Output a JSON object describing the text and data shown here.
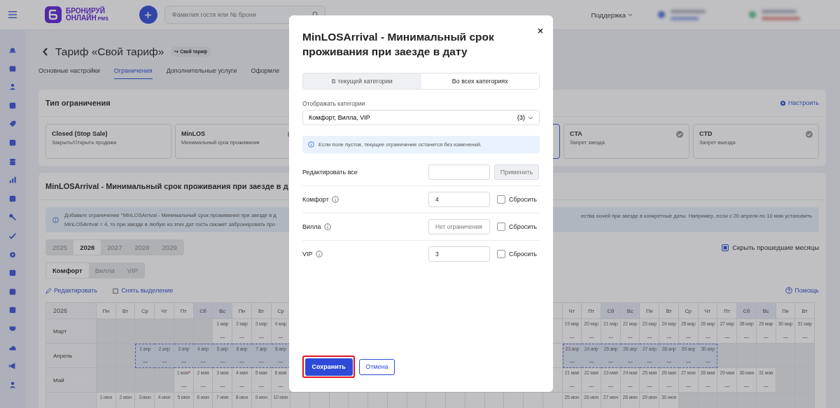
{
  "topbar": {
    "logo_line1": "БРОНИРУЙ",
    "logo_line2": "ОНЛАЙН",
    "logo_suffix": "PMS",
    "search": {
      "placeholder": "Фамилия гостя или № брони"
    },
    "support": "Поддержка"
  },
  "page": {
    "title": "Тариф «Свой тариф»",
    "badge_icon": "↪",
    "badge": "Свой тариф"
  },
  "tabs": [
    {
      "label": "Основные настройки",
      "selected": false
    },
    {
      "label": "Ограничения",
      "selected": true
    },
    {
      "label": "Дополнительные услуги",
      "selected": false
    },
    {
      "label": "Оформле",
      "selected": false
    }
  ],
  "restriction_types": {
    "title": "Тип ограничения",
    "action": "Настроить",
    "cards_left": [
      {
        "title": "Closed (Stop Sale)",
        "subtitle": "Закрыть/Открыть продажи",
        "checked": false,
        "selected": false
      },
      {
        "title": "MinLOS",
        "subtitle": "Минимальный срок проживания",
        "checked": true,
        "selected": false
      }
    ],
    "cards_right": [
      {
        "selected": true
      },
      {
        "title": "CTA",
        "subtitle": "Запрет заезда",
        "checked": true,
        "selected": false
      },
      {
        "title": "CTD",
        "subtitle": "Запрет выезда",
        "checked": true,
        "selected": false
      }
    ]
  },
  "calendar_section": {
    "title": "MinLOSArrival - Минимальный срок проживания при заезде в д",
    "info_left": [
      "Добавьте ограничение \"MinLOSArrival - Минимальный срок проживания при заезде в д",
      "MinLOSArrival = 4, то при заезде в любую из этих дат гость сможет забронировать про"
    ],
    "info_right": "ества ночей при заезде в конкретные даты. Например, если с 20 апреля по 10 мая установить",
    "years": [
      {
        "label": "2025",
        "selected": false
      },
      {
        "label": "2026",
        "selected": true
      },
      {
        "label": "2027",
        "selected": false
      },
      {
        "label": "2028",
        "selected": false
      },
      {
        "label": "2029",
        "selected": false
      }
    ],
    "hide_past": {
      "label": "Скрыть прошедшие месяцы",
      "checked": true
    },
    "categories": [
      {
        "label": "Комфорт",
        "selected": true
      },
      {
        "label": "Вилла",
        "selected": false
      },
      {
        "label": "VIP",
        "selected": false
      }
    ],
    "edit": "Редактировать",
    "clear": "Снять выделение",
    "help": "Помощь",
    "table": {
      "corner": "2026",
      "days_left": [
        {
          "label": "Пн",
          "weekend": false
        },
        {
          "label": "Вт",
          "weekend": false
        },
        {
          "label": "Ср",
          "weekend": false
        },
        {
          "label": "Чт",
          "weekend": false
        },
        {
          "label": "Пт",
          "weekend": false
        },
        {
          "label": "Сб",
          "weekend": true
        },
        {
          "label": "Вс",
          "weekend": true
        },
        {
          "label": "Пн",
          "weekend": false
        },
        {
          "label": "Вт",
          "weekend": false
        },
        {
          "label": "Ср",
          "weekend": false
        }
      ],
      "days_right": [
        {
          "label": "Чт",
          "weekend": false
        },
        {
          "label": "Пт",
          "weekend": false
        },
        {
          "label": "Сб",
          "weekend": true
        },
        {
          "label": "Вс",
          "weekend": true
        },
        {
          "label": "Пн",
          "weekend": false
        },
        {
          "label": "Вт",
          "weekend": false
        },
        {
          "label": "Ср",
          "weekend": false
        },
        {
          "label": "Чт",
          "weekend": false
        },
        {
          "label": "Пт",
          "weekend": false
        },
        {
          "label": "Сб",
          "weekend": true
        },
        {
          "label": "Вс",
          "weekend": true
        },
        {
          "label": "Пн",
          "weekend": false
        },
        {
          "label": "Вт",
          "weekend": false
        }
      ],
      "rows": [
        {
          "month": "Март",
          "left": [
            {
              "kind": "empty"
            },
            {
              "kind": "empty"
            },
            {
              "kind": "empty"
            },
            {
              "kind": "empty"
            },
            {
              "kind": "empty"
            },
            {
              "kind": "empty"
            },
            {
              "kind": "day",
              "date": "1 мар",
              "value": "—",
              "selected": false
            },
            {
              "kind": "day",
              "date": "2 мар",
              "value": "—",
              "selected": false
            },
            {
              "kind": "day",
              "date": "3 мар",
              "value": "—",
              "selected": false
            },
            {
              "kind": "day",
              "date": "4 мар",
              "value": "—",
              "selected": false
            }
          ],
          "right": [
            {
              "kind": "day",
              "date": "19 мар",
              "value": "—",
              "selected": false
            },
            {
              "kind": "day",
              "date": "20 мар",
              "value": "—",
              "selected": false
            },
            {
              "kind": "day",
              "date": "21 мар",
              "value": "—",
              "selected": false
            },
            {
              "kind": "day",
              "date": "22 мар",
              "value": "—",
              "selected": false
            },
            {
              "kind": "day",
              "date": "23 мар",
              "value": "—",
              "selected": false
            },
            {
              "kind": "day",
              "date": "24 мар",
              "value": "—",
              "selected": false
            },
            {
              "kind": "day",
              "date": "25 мар",
              "value": "—",
              "selected": false
            },
            {
              "kind": "day",
              "date": "26 мар",
              "value": "—",
              "selected": false
            },
            {
              "kind": "day",
              "date": "27 мар",
              "value": "—",
              "selected": false
            },
            {
              "kind": "day",
              "date": "28 мар",
              "value": "—",
              "selected": false
            },
            {
              "kind": "day",
              "date": "29 мар",
              "value": "—",
              "selected": false
            },
            {
              "kind": "day",
              "date": "30 мар",
              "value": "—",
              "selected": false
            },
            {
              "kind": "day",
              "date": "31 мар",
              "value": "—",
              "selected": false
            }
          ]
        },
        {
          "month": "Апрель",
          "left": [
            {
              "kind": "empty"
            },
            {
              "kind": "empty"
            },
            {
              "kind": "day",
              "date": "1 апр",
              "value": "—",
              "selected": true
            },
            {
              "kind": "day",
              "date": "2 апр",
              "value": "—",
              "selected": true
            },
            {
              "kind": "day",
              "date": "3 апр",
              "value": "—",
              "selected": true
            },
            {
              "kind": "day",
              "date": "4 апр",
              "value": "—",
              "selected": true
            },
            {
              "kind": "day",
              "date": "5 апр",
              "value": "—",
              "selected": true
            },
            {
              "kind": "day",
              "date": "6 апр",
              "value": "—",
              "selected": true
            },
            {
              "kind": "day",
              "date": "7 апр",
              "value": "—",
              "selected": true
            },
            {
              "kind": "day",
              "date": "8 апр",
              "value": "—",
              "selected": true
            }
          ],
          "right": [
            {
              "kind": "day",
              "date": "23 апр",
              "value": "—",
              "selected": true
            },
            {
              "kind": "day",
              "date": "24 апр",
              "value": "—",
              "selected": true
            },
            {
              "kind": "day",
              "date": "25 апр",
              "value": "—",
              "selected": true
            },
            {
              "kind": "day",
              "date": "26 апр",
              "value": "—",
              "selected": true
            },
            {
              "kind": "day",
              "date": "27 апр",
              "value": "—",
              "selected": true
            },
            {
              "kind": "day",
              "date": "28 апр",
              "value": "—",
              "selected": true
            },
            {
              "kind": "day",
              "date": "29 апр",
              "value": "—",
              "selected": true
            },
            {
              "kind": "day",
              "date": "30 апр",
              "value": "—",
              "selected": true
            },
            {
              "kind": "empty"
            },
            {
              "kind": "empty"
            },
            {
              "kind": "empty"
            },
            {
              "kind": "empty"
            },
            {
              "kind": "empty"
            }
          ]
        },
        {
          "month": "Май",
          "left": [
            {
              "kind": "empty"
            },
            {
              "kind": "empty"
            },
            {
              "kind": "empty"
            },
            {
              "kind": "empty"
            },
            {
              "kind": "day",
              "date": "1 мая",
              "mark": "*",
              "value": "—",
              "selected": false
            },
            {
              "kind": "day",
              "date": "2 мая",
              "value": "—",
              "selected": false
            },
            {
              "kind": "day",
              "date": "3 мая",
              "value": "—",
              "selected": false
            },
            {
              "kind": "day",
              "date": "4 мая",
              "value": "—",
              "selected": false
            },
            {
              "kind": "day",
              "date": "5 мая",
              "value": "—",
              "selected": false
            },
            {
              "kind": "day",
              "date": "6 мая",
              "value": "—",
              "selected": false
            }
          ],
          "right": [
            {
              "kind": "day",
              "date": "21 мая",
              "value": "—",
              "selected": false
            },
            {
              "kind": "day",
              "date": "22 мая",
              "value": "—",
              "selected": false
            },
            {
              "kind": "day",
              "date": "23 мая",
              "value": "—",
              "selected": false
            },
            {
              "kind": "day",
              "date": "24 мая",
              "value": "—",
              "selected": false
            },
            {
              "kind": "day",
              "date": "25 мая",
              "value": "—",
              "selected": false
            },
            {
              "kind": "day",
              "date": "26 мая",
              "value": "—",
              "selected": false
            },
            {
              "kind": "day",
              "date": "27 мая",
              "value": "—",
              "selected": false
            },
            {
              "kind": "day",
              "date": "28 мая",
              "value": "—",
              "selected": false
            },
            {
              "kind": "day",
              "date": "29 мая",
              "value": "—",
              "selected": false
            },
            {
              "kind": "day",
              "date": "30 мая",
              "value": "—",
              "selected": false
            },
            {
              "kind": "day",
              "date": "31 мая",
              "value": "—",
              "selected": false
            },
            {
              "kind": "empty"
            },
            {
              "kind": "empty"
            }
          ]
        },
        {
          "left": [
            {
              "kind": "day",
              "date": "1 июн",
              "selected": false
            },
            {
              "kind": "day",
              "date": "2 июн",
              "selected": false
            },
            {
              "kind": "day",
              "date": "3 июн",
              "selected": false
            },
            {
              "kind": "day",
              "date": "4 июн",
              "selected": false
            },
            {
              "kind": "day",
              "date": "5 июн",
              "selected": false
            },
            {
              "kind": "day",
              "date": "6 июн",
              "selected": false
            },
            {
              "kind": "day",
              "date": "7 июн",
              "selected": false
            },
            {
              "kind": "day",
              "date": "8 июн",
              "selected": false
            },
            {
              "kind": "day",
              "date": "9 июн",
              "selected": false
            },
            {
              "kind": "day",
              "date": "10 июн",
              "selected": false
            }
          ],
          "right": [
            {
              "kind": "day",
              "date": "25 июн",
              "selected": false
            },
            {
              "kind": "day",
              "date": "26 июн",
              "selected": false
            },
            {
              "kind": "day",
              "date": "27 июн",
              "selected": false
            },
            {
              "kind": "day",
              "date": "28 июн",
              "selected": false
            },
            {
              "kind": "day",
              "date": "29 июн",
              "selected": false
            },
            {
              "kind": "day",
              "date": "30 июн",
              "selected": false
            },
            {
              "kind": "empty"
            },
            {
              "kind": "empty"
            },
            {
              "kind": "empty"
            },
            {
              "kind": "empty"
            },
            {
              "kind": "empty"
            },
            {
              "kind": "empty"
            },
            {
              "kind": "empty"
            }
          ]
        }
      ]
    }
  },
  "dialog": {
    "title": "MinLOSArrival - Минимальный срок проживания при заезде в дату",
    "scopes": [
      {
        "label": "В текущей категории",
        "selected": false
      },
      {
        "label": "Во всех категориях",
        "selected": true
      }
    ],
    "categories_label": "Отображать категории",
    "categories_value": "Комфорт, Вилла, VIP",
    "categories_count": "(3)",
    "info": "Если поле пустов, текущее ограничение останется без изменений.",
    "edit_all": {
      "label": "Редактировать все",
      "button": "Применить"
    },
    "rows": [
      {
        "label": "Комфорт",
        "value": "4",
        "reset_label": "Сбросить",
        "reset": false
      },
      {
        "label": "Вилла",
        "placeholder": "Нет ограничения",
        "reset_label": "Сбросить",
        "reset": false
      },
      {
        "label": "VIP",
        "value": "3",
        "reset_label": "Сбросить",
        "reset": false
      }
    ],
    "save": "Сохранить",
    "cancel": "Отмена",
    "save_highlighted": true
  }
}
